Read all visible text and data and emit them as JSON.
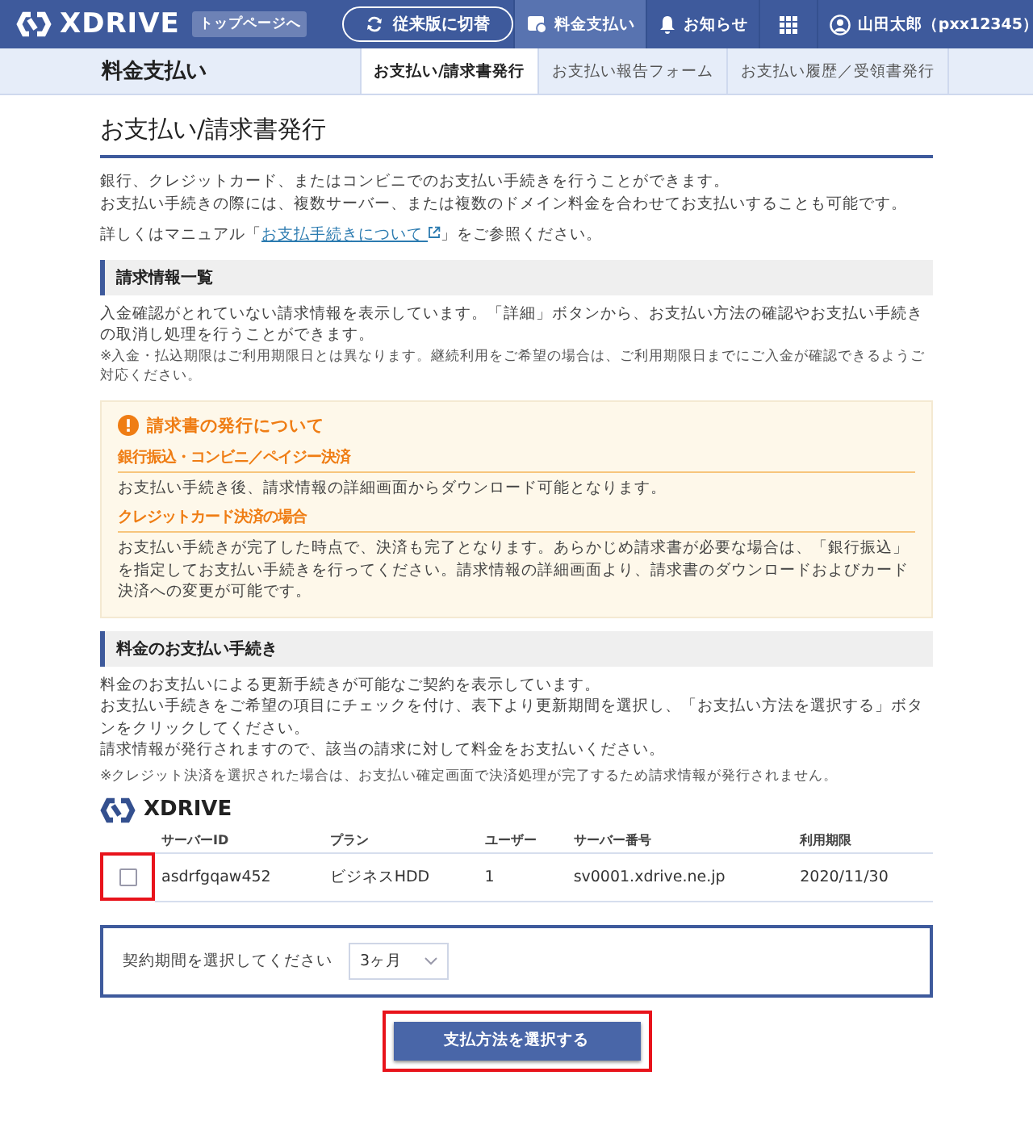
{
  "header": {
    "logo": "XDRIVE",
    "top_link": "トップページへ",
    "switch_button": "従来版に切替",
    "nav": [
      {
        "kind": "billing",
        "label": "料金支払い",
        "selected": true
      },
      {
        "kind": "bell",
        "label": "お知らせ",
        "selected": false
      },
      {
        "kind": "grid",
        "selected": false
      },
      {
        "kind": "user",
        "label": "山田太郎（pxx12345）",
        "selected": false
      }
    ]
  },
  "subnav": {
    "title": "料金支払い",
    "tabs": [
      {
        "label": "お支払い/請求書発行",
        "selected": true
      },
      {
        "label": "お支払い報告フォーム",
        "selected": false
      },
      {
        "label": "お支払い履歴／受領書発行",
        "selected": false
      }
    ]
  },
  "page_title": "お支払い/請求書発行",
  "intro": [
    "銀行、クレジットカード、またはコンビニでのお支払い手続きを行うことができます。",
    "お支払い手続きの際には、複数サーバー、または複数のドメイン料金を合わせてお支払いすることも可能です。"
  ],
  "manual": {
    "prefix": "詳しくはマニュアル「",
    "link": "お支払手続きについて",
    "suffix": "」をご参照ください。"
  },
  "billing_list": {
    "heading": "請求情報一覧",
    "description": "入金確認がとれていない請求情報を表示しています。「詳細」ボタンから、お支払い方法の確認やお支払い手続きの取消し処理を行うことができます。",
    "note": "※入金・払込期限はご利用期限日とは異なります。継続利用をご希望の場合は、ご利用期限日までにご入金が確認できるようご対応ください。"
  },
  "notice": {
    "title": "請求書の発行について",
    "items": [
      {
        "heading": "銀行振込・コンビニ／ペイジー決済",
        "text": "お支払い手続き後、請求情報の詳細画面からダウンロード可能となります。"
      },
      {
        "heading": "クレジットカード決済の場合",
        "text": "お支払い手続きが完了した時点で、決済も完了となります。あらかじめ請求書が必要な場合は、「銀行振込」を指定してお支払い手続きを行ってください。請求情報の詳細画面より、請求書のダウンロードおよびカード決済への変更が可能です。"
      }
    ]
  },
  "payment": {
    "heading": "料金のお支払い手続き",
    "lines": [
      "料金のお支払いによる更新手続きが可能なご契約を表示しています。",
      "お支払い手続きをご希望の項目にチェックを付け、表下より更新期間を選択し、「お支払い方法を選択する」ボタンをクリックしてください。",
      "請求情報が発行されますので、該当の請求に対して料金をお支払いください。"
    ],
    "note": "※クレジット決済を選択された場合は、お支払い確定画面で決済処理が完了するため請求情報が発行されません。"
  },
  "product_logo": "XDRIVE",
  "table": {
    "columns": [
      "サーバーID",
      "プラン",
      "ユーザー",
      "サーバー番号",
      "利用期限"
    ],
    "rows": [
      {
        "checked": false,
        "highlighted": true,
        "cells": [
          "asdrfgqaw452",
          "ビジネスHDD",
          "1",
          "sv0001.xdrive.ne.jp",
          "2020/11/30"
        ]
      }
    ]
  },
  "period": {
    "label": "契約期間を選択してください",
    "value": "3ヶ月"
  },
  "submit": {
    "label": "支払方法を選択する",
    "highlighted": true
  }
}
